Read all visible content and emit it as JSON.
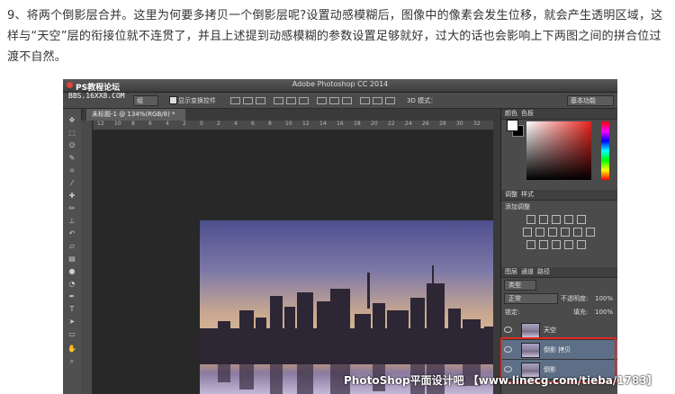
{
  "article": {
    "text": "9、将两个倒影层合并。这里为何要多拷贝一个倒影层呢?设置动感模糊后，图像中的像素会发生位移，就会产生透明区域，这样与“天空”层的衔接位就不连贯了，并且上述提到动感模糊的参数设置足够就好，过大的话也会影响上下两图之间的拼合位过渡不自然。"
  },
  "watermark": {
    "logo_text": "PS教程论坛",
    "url": "BBS.16XX8.COM",
    "bottom": "PhotoShop平面设计吧 【www.linecg.com/tieba/1783】"
  },
  "app": {
    "title": "Adobe Photoshop CC 2014"
  },
  "options_bar": {
    "mode": "组",
    "show_transform": "显示变换控件",
    "label_3d": "3D 模式：",
    "workspace": "基本功能"
  },
  "document": {
    "tab_label": "未标题-1 @ 134%(RGB/8) *",
    "ruler_ticks": [
      "12",
      "10",
      "8",
      "6",
      "4",
      "2",
      "0",
      "2",
      "4",
      "6",
      "8",
      "10",
      "12",
      "14",
      "16",
      "18",
      "20",
      "22",
      "24",
      "26",
      "28",
      "30",
      "32"
    ]
  },
  "panels": {
    "color_tabs": [
      "颜色",
      "色板"
    ],
    "adjust_tabs": [
      "调整",
      "样式"
    ],
    "add_adjustment": "添加调整",
    "layer_tabs": [
      "图层",
      "通道",
      "路径"
    ],
    "filter_kind": "类型",
    "blend_mode": "正常",
    "opacity_label": "不透明度:",
    "opacity_value": "100%",
    "lock_label": "锁定:",
    "fill_label": "填充:",
    "fill_value": "100%"
  },
  "layers": [
    {
      "name": "天空",
      "selected": false
    },
    {
      "name": "倒影 拷贝",
      "selected": true
    },
    {
      "name": "倒影",
      "selected": true
    }
  ],
  "colors": {
    "highlight_box": "#e0291e",
    "selected_layer": "#5d6f86",
    "ui_dark": "#3a3a3a"
  }
}
